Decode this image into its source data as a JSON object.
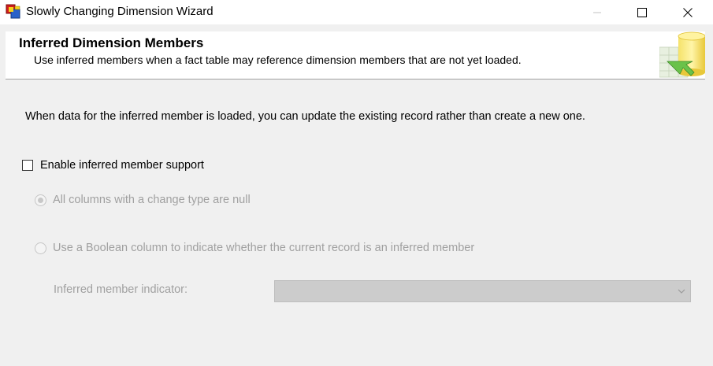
{
  "window": {
    "title": "Slowly Changing Dimension Wizard",
    "controls": [
      "minimize-icon",
      "maximize-icon",
      "close-icon"
    ]
  },
  "header": {
    "title": "Inferred Dimension Members",
    "subtitle": "Use inferred members when a fact table may reference dimension members that are not yet loaded."
  },
  "body": {
    "description": "When data for the inferred member is loaded, you can update the existing record rather than create a new one.",
    "enable_checkbox": {
      "label": "Enable inferred member support",
      "checked": false
    },
    "options": [
      {
        "label": "All columns with a change type are null",
        "selected": true,
        "enabled": false
      },
      {
        "label": "Use a Boolean column to indicate whether the current record is an inferred member",
        "selected": false,
        "enabled": false
      }
    ],
    "indicator": {
      "label": "Inferred member indicator:",
      "value": "",
      "enabled": false
    }
  },
  "colors": {
    "background": "#f0f0f0",
    "header_background": "#ffffff",
    "disabled_text": "#a0a0a0",
    "disabled_combo": "#cccccc"
  }
}
